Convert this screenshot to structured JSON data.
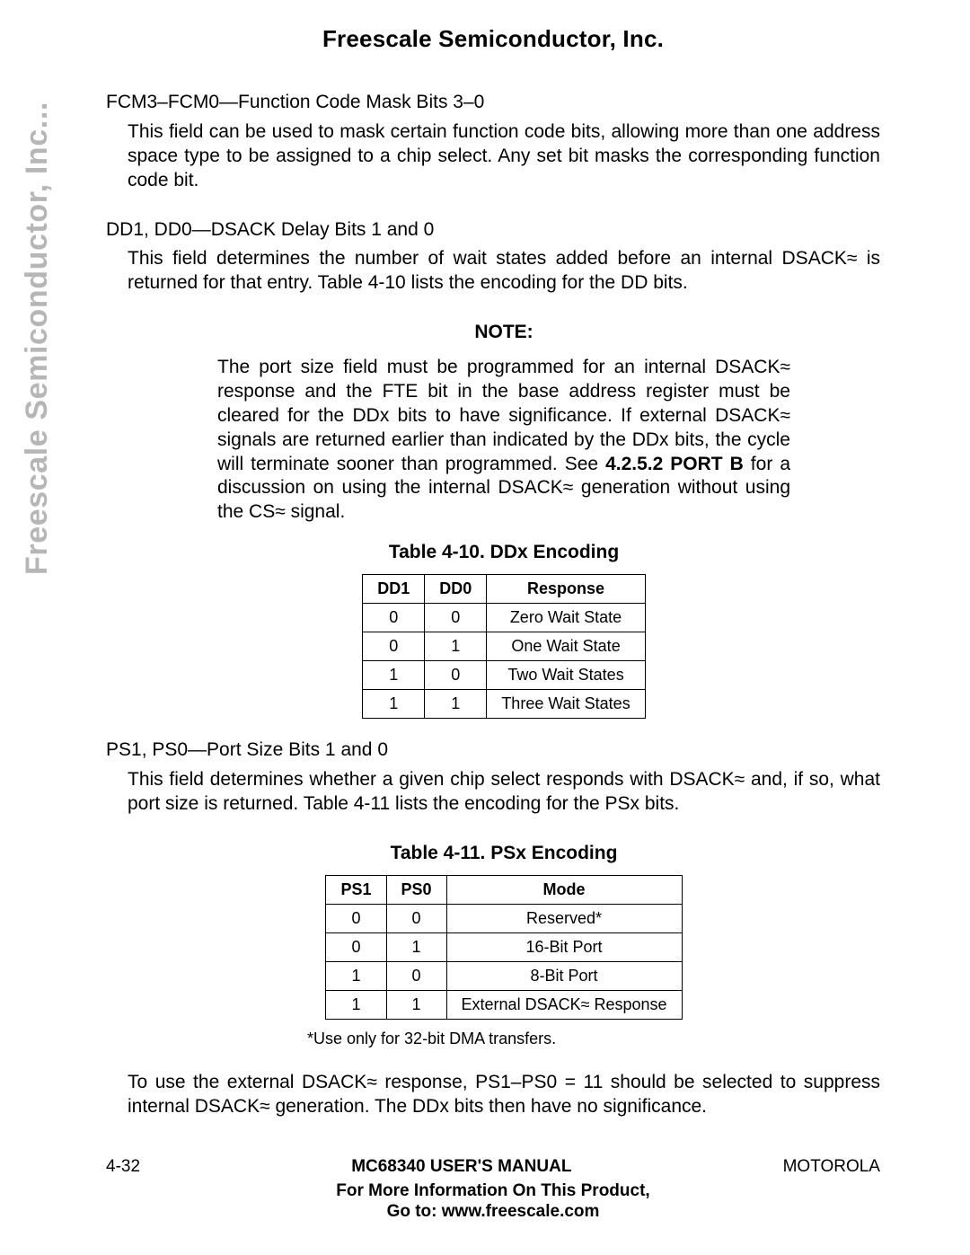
{
  "header": {
    "company": "Freescale Semiconductor, Inc."
  },
  "side_text": "Freescale Semiconductor, Inc...",
  "sections": {
    "fcm": {
      "title": "FCM3–FCM0—Function Code Mask Bits 3–0",
      "body": "This field can be used to mask certain function code bits, allowing more than one address space type to be assigned to a chip select. Any set bit masks the corresponding function code bit."
    },
    "dd": {
      "title": "DD1, DD0—DSACK Delay Bits 1 and 0",
      "body_pre": "This field determines the number of wait states added before an internal ",
      "body_sig": "DSACK≈",
      "body_post": " is returned for that entry. Table 4-10 lists the encoding for the DD bits."
    },
    "note": {
      "label": "NOTE:",
      "body_1": "The port size field must be programmed for an internal ",
      "sig1": "DSACK≈",
      "body_2": " response and the FTE bit in the base address register must be cleared for the DDx bits to have  significance. If external ",
      "sig2": "DSACK≈",
      "body_3": " signals are returned earlier than indicated by the DDx bits, the cycle will terminate sooner than programmed. See ",
      "port_b": "4.2.5.2 PORT B",
      "body_4": " for a discussion on using the internal ",
      "sig3": "DSACK≈",
      "body_5": " generation without using the ",
      "sig4": "CS≈",
      "body_6": " signal."
    },
    "table_ddx": {
      "title": "Table 4-10. DDx Encoding",
      "headers": [
        "DD1",
        "DD0",
        "Response"
      ],
      "rows": [
        [
          "0",
          "0",
          "Zero Wait State"
        ],
        [
          "0",
          "1",
          "One Wait State"
        ],
        [
          "1",
          "0",
          "Two Wait States"
        ],
        [
          "1",
          "1",
          "Three Wait States"
        ]
      ]
    },
    "ps": {
      "title": "PS1, PS0—Port Size Bits 1 and 0",
      "body_pre": "This field determines whether a given chip select responds with ",
      "sig": "DSACK≈",
      "body_post": " and, if so, what port size is returned. Table 4-11 lists the encoding for the PSx bits."
    },
    "table_psx": {
      "title": "Table 4-11. PSx Encoding",
      "headers": [
        "PS1",
        "PS0",
        "Mode"
      ],
      "rows": [
        [
          "0",
          "0",
          "Reserved*"
        ],
        [
          "0",
          "1",
          "16-Bit Port"
        ],
        [
          "1",
          "0",
          "8-Bit Port"
        ],
        [
          "1",
          "1",
          "External DSACK≈ Response"
        ]
      ],
      "footnote": "*Use only for 32-bit DMA transfers."
    },
    "final": {
      "pre": "To use the external ",
      "sig1": "DSACK≈",
      "mid": " response, PS1–PS0 = 11 should be selected to suppress internal ",
      "sig2": "DSACK≈",
      "post": " generation. The DDx bits then have no significance."
    }
  },
  "footer": {
    "left": "4-32",
    "center": "MC68340 USER'S MANUAL",
    "right": "MOTOROLA",
    "line1": "For More Information On This Product,",
    "line2": "Go to: www.freescale.com"
  }
}
